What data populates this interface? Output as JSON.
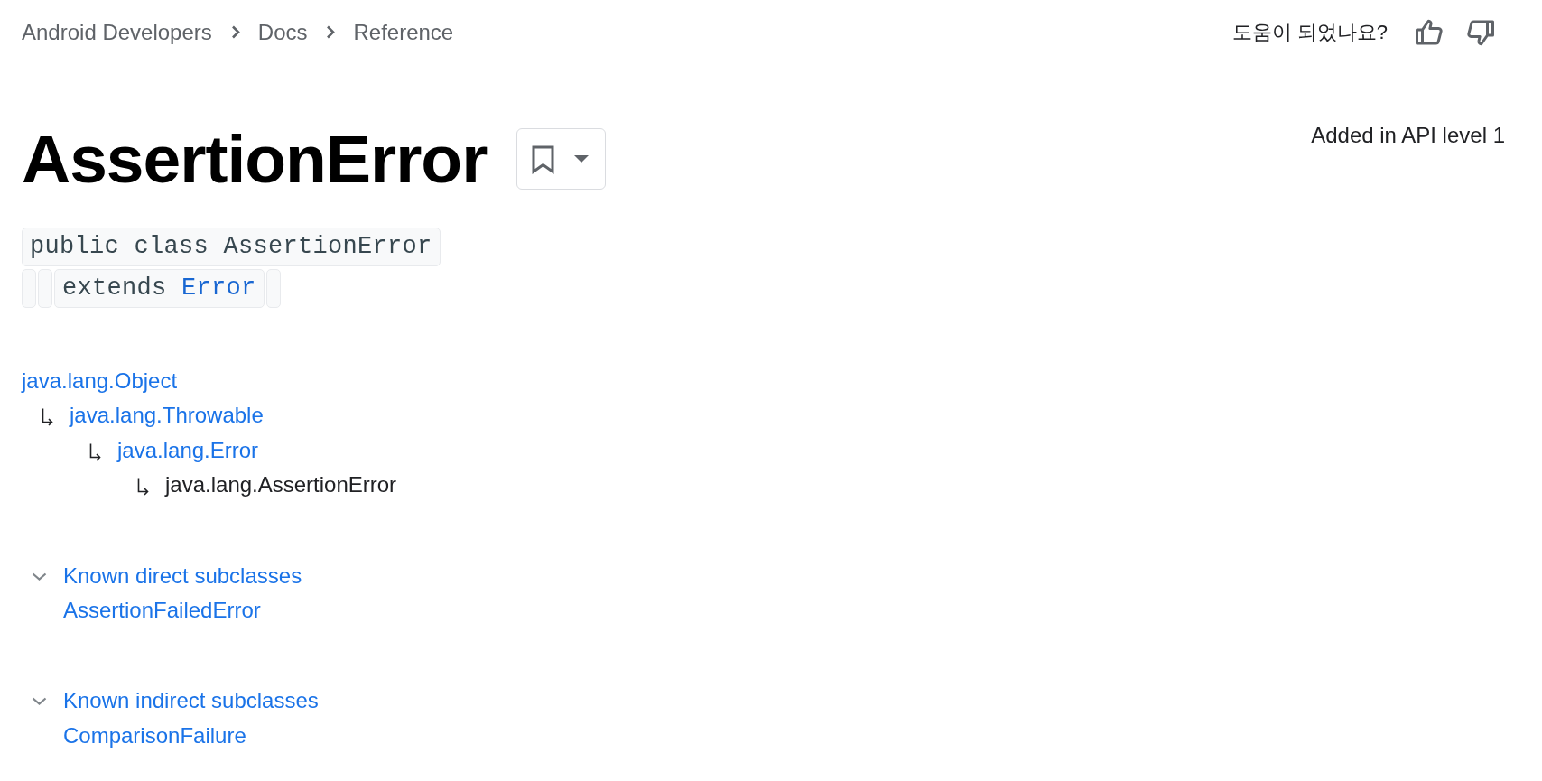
{
  "breadcrumbs": [
    "Android Developers",
    "Docs",
    "Reference"
  ],
  "feedback": {
    "question": "도움이 되었나요?"
  },
  "title": "AssertionError",
  "api_level": "Added in API level 1",
  "signature": [
    {
      "parts": [
        {
          "text": "public class AssertionError",
          "link": false
        }
      ]
    },
    {
      "parts": [
        {
          "text": "extends",
          "link": false
        },
        {
          "text": "Error",
          "link": true
        }
      ]
    }
  ],
  "hierarchy": [
    {
      "label": "java.lang.Object",
      "current": false,
      "children": [
        {
          "label": "java.lang.Throwable",
          "current": false,
          "children": [
            {
              "label": "java.lang.Error",
              "current": false,
              "children": [
                {
                  "label": "java.lang.AssertionError",
                  "current": true
                }
              ]
            }
          ]
        }
      ]
    }
  ],
  "subclass_sections": [
    {
      "title": "Known direct subclasses",
      "expanded": true,
      "items": [
        "AssertionFailedError"
      ]
    },
    {
      "title": "Known indirect subclasses",
      "expanded": true,
      "items": [
        "ComparisonFailure"
      ]
    }
  ]
}
